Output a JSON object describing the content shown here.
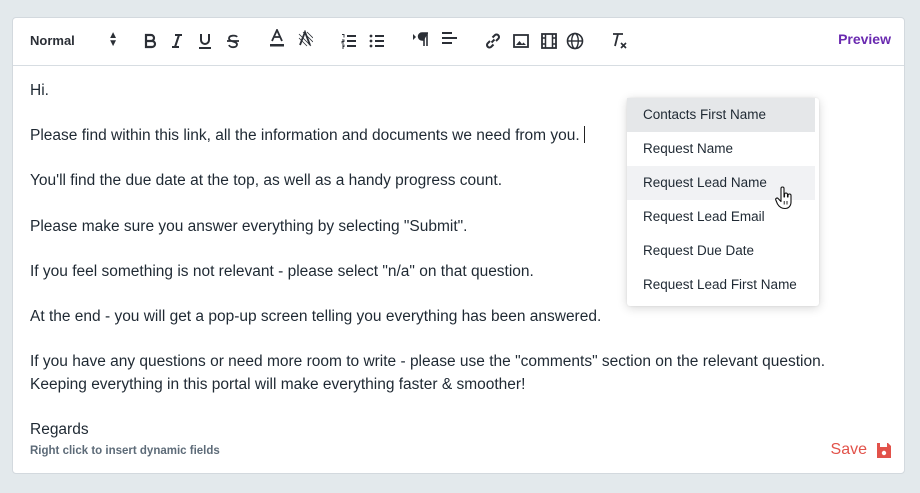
{
  "toolbar": {
    "format_value": "Normal",
    "caret_up": "▲",
    "caret_down": "▼",
    "preview_label": "Preview",
    "icons": [
      "bold-icon",
      "italic-icon",
      "underline-icon",
      "strikethrough-icon",
      "text-color-icon",
      "highlight-color-icon",
      "ordered-list-icon",
      "bullet-list-icon",
      "text-direction-icon",
      "align-icon",
      "link-icon",
      "image-icon",
      "video-icon",
      "globe-icon",
      "clear-format-icon"
    ]
  },
  "content": {
    "greeting": "Hi.",
    "line1": "Please find within this link, all the information and documents we need from you.",
    "line2": "You'll find the due date at the top, as well as a handy progress count.",
    "line3": "Please make sure you answer everything by selecting \"Submit\".",
    "line4": "If you feel something is not relevant - please select \"n/a\" on that question.",
    "line5": "At the end - you will get a pop-up screen telling you everything has been answered.",
    "line6": "If you have any questions or need more room to write - please use the \"comments\" section on the relevant question.",
    "line7": "Keeping everything in this portal will make everything faster & smoother!",
    "signoff": "Regards"
  },
  "footer": {
    "hint": "Right click to insert dynamic fields",
    "save_label": "Save"
  },
  "dropdown": {
    "items": [
      {
        "label": "Contacts First Name"
      },
      {
        "label": "Request Name"
      },
      {
        "label": "Request Lead Name"
      },
      {
        "label": "Request Lead Email"
      },
      {
        "label": "Request Due Date"
      },
      {
        "label": "Request Lead First Name"
      }
    ]
  },
  "colors": {
    "accent": "#6a2ab0",
    "save": "#e2524a",
    "background": "#e3e9ec"
  }
}
